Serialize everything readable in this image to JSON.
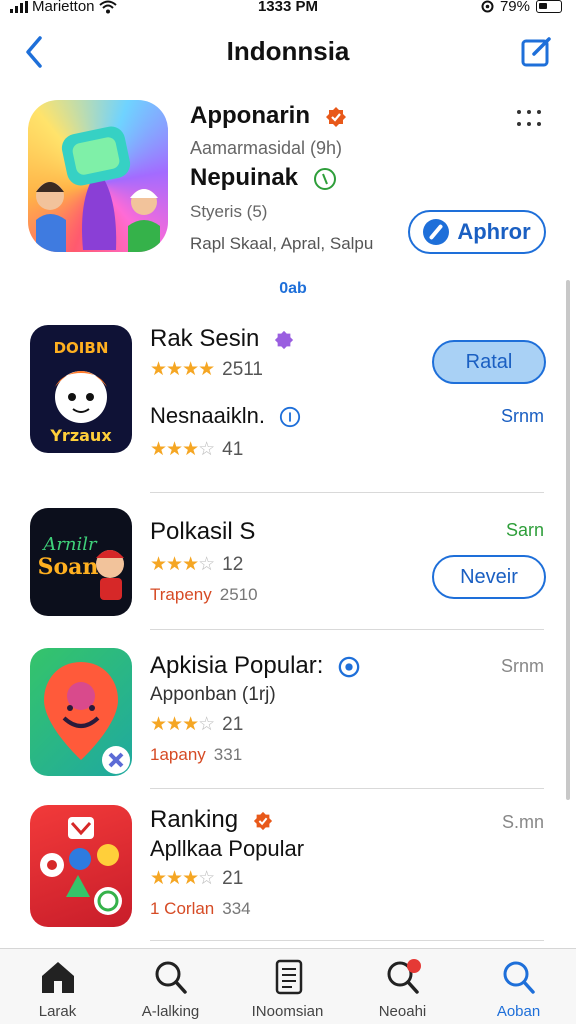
{
  "status_bar": {
    "carrier": "Marietton",
    "time": "1333 PM",
    "battery": "79%"
  },
  "nav": {
    "title": "Indonnsia"
  },
  "featured": {
    "title": "Apponarin",
    "subtitle": "Aamarmasidal (9h)",
    "name": "Nepuinak",
    "meta1": "Styeris (5)",
    "meta2": "Rapl Skaal, Apral, Salpu",
    "button_label": "Aphror",
    "page_indicator": "0ab"
  },
  "list": [
    {
      "title": "Rak Sesin",
      "rating": 4,
      "count": "2511",
      "second_title": "Nesnaaikln.",
      "second_rating": 3,
      "second_count": "41",
      "button": "Ratal",
      "size": "Srnm",
      "icon_text_top": "DOIBN",
      "icon_text_bottom": "Yrzaux"
    },
    {
      "title": "Polkasil S",
      "rating": 3,
      "count": "12",
      "developer": "Trapeny",
      "dev_count": "2510",
      "button": "Neveir",
      "size": "Sarn",
      "icon_text_top": "Arnilr",
      "icon_text_bottom": "Soan"
    },
    {
      "title": "Apkisia Popular:",
      "subtitle": "Apponban (1rj)",
      "rating": 3,
      "count": "21",
      "developer": "1apany",
      "dev_count": "331",
      "size": "Srnm"
    },
    {
      "title": "Ranking",
      "subtitle": "Apllkaa Popular",
      "rating": 3,
      "count": "21",
      "developer": "1 Corlan",
      "dev_count": "334",
      "size": "S.mn"
    }
  ],
  "tabs": [
    {
      "label": "Larak"
    },
    {
      "label": "A-lalking"
    },
    {
      "label": "INoomsian"
    },
    {
      "label": "Neoahi"
    },
    {
      "label": "Aoban"
    }
  ],
  "colors": {
    "accent": "#1e6fd9",
    "star": "#f5a623",
    "developer_red": "#d64b25",
    "size_green": "#2e9e3a"
  }
}
